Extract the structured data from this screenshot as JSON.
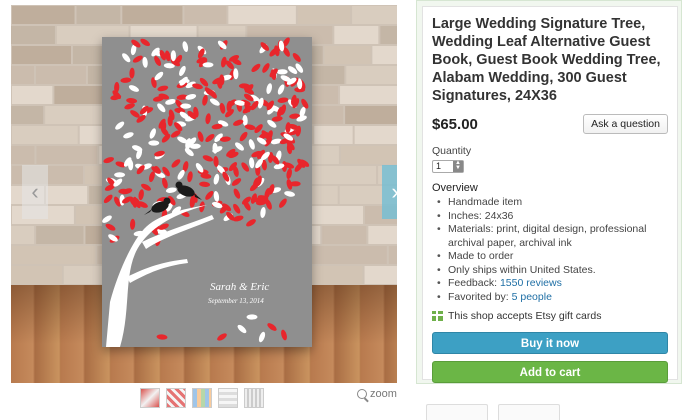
{
  "listing": {
    "title": "Large Wedding Signature Tree, Wedding Leaf Alternative Guest Book, Guest Book Wedding Tree, Alabam Wedding, 300 Guest Signatures, 24X36",
    "price": "$65.00",
    "ask_label": "Ask a question",
    "quantity_label": "Quantity",
    "quantity_value": "1",
    "overview_heading": "Overview",
    "overview": {
      "item1": "Handmade item",
      "item2": "Inches: 24x36",
      "item3": "Materials: print, digital design, professional archival paper, archival ink",
      "item4": "Made to order",
      "item5": "Only ships within United States.",
      "feedback_label": "Feedback: ",
      "feedback_link": "1550 reviews",
      "favorited_label": "Favorited by: ",
      "favorited_link": "5 people"
    },
    "gift_text": "This shop accepts Etsy gift cards",
    "buy_label": "Buy it now",
    "cart_label": "Add to cart"
  },
  "gallery": {
    "poster_names": "Sarah & Eric",
    "poster_date": "September 13, 2014",
    "zoom_label": "zoom",
    "thumbnail_count": 5
  },
  "colors": {
    "buy_button": "#3da0c4",
    "cart_button": "#6bb646",
    "link": "#1f6fa5",
    "panel_bg": "#f1f7ef",
    "leaf_red": "#e8262c"
  }
}
